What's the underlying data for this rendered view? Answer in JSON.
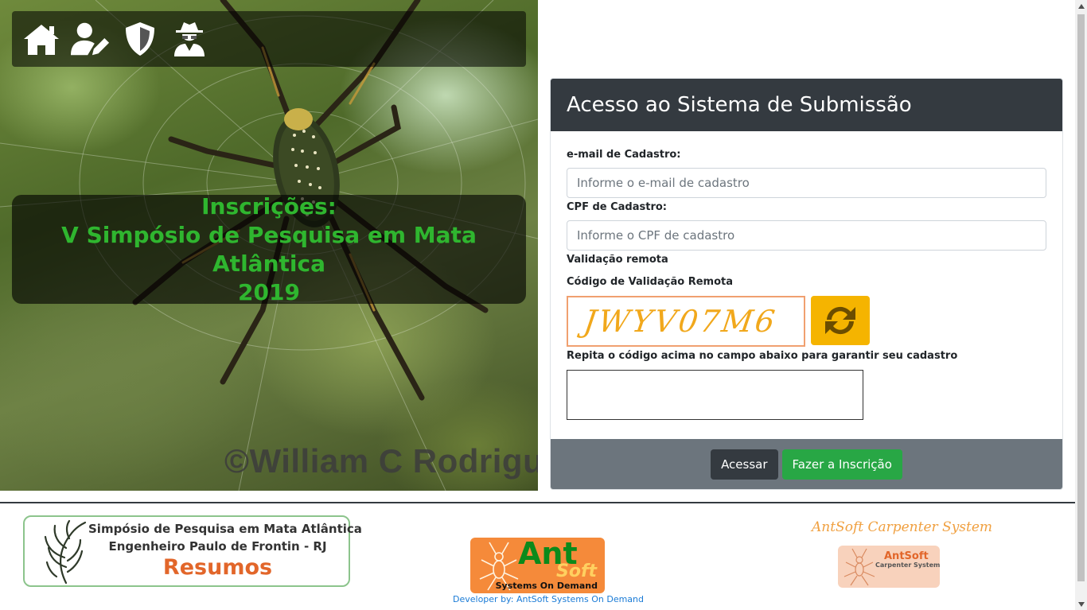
{
  "nav": {
    "icons": [
      "home-icon",
      "user-edit-icon",
      "shield-icon",
      "user-secret-icon"
    ]
  },
  "hero": {
    "title_line1": "Inscrições:",
    "title_line2": "V Simpósio de Pesquisa em Mata Atlântica",
    "title_line3": "2019",
    "watermark": "©William C Rodrigu"
  },
  "login": {
    "header": "Acesso ao Sistema de Submissão",
    "email_label": "e-mail de Cadastro:",
    "email_placeholder": "Informe o e-mail de cadastro",
    "cpf_label": "CPF de Cadastro:",
    "cpf_placeholder": "Informe o CPF de cadastro",
    "remote_validation_label": "Validação remota",
    "captcha_label": "Código de Validação Remota",
    "captcha_text": "JWYV07M6",
    "repeat_label": "Repita o código acima no campo abaixo para garantir seu cadastro",
    "code_value": "",
    "access_button": "Acessar",
    "register_button": "Fazer a Inscrição"
  },
  "footer": {
    "logo_line1": "Simpósio de Pesquisa em Mata Atlântica",
    "logo_line2": "Engenheiro Paulo de Frontin - RJ",
    "logo_line3": "Resumos",
    "antsoft_word1": "Ant",
    "antsoft_word2": "Soft",
    "antsoft_tagline": "Systems On Demand",
    "developer_link": "Developer by: AntSoft Systems On Demand",
    "carpenter_title": "AntSoft Carpenter System",
    "carpenter_badge_line1": "AntSoft",
    "carpenter_badge_line2": "Carpenter System"
  },
  "colors": {
    "accent_green": "#2fb62f",
    "card_header": "#343a40",
    "card_footer": "#6c757d",
    "button_green": "#28a745",
    "refresh_yellow": "#f5b400",
    "captcha_text": "#f1a81c"
  }
}
